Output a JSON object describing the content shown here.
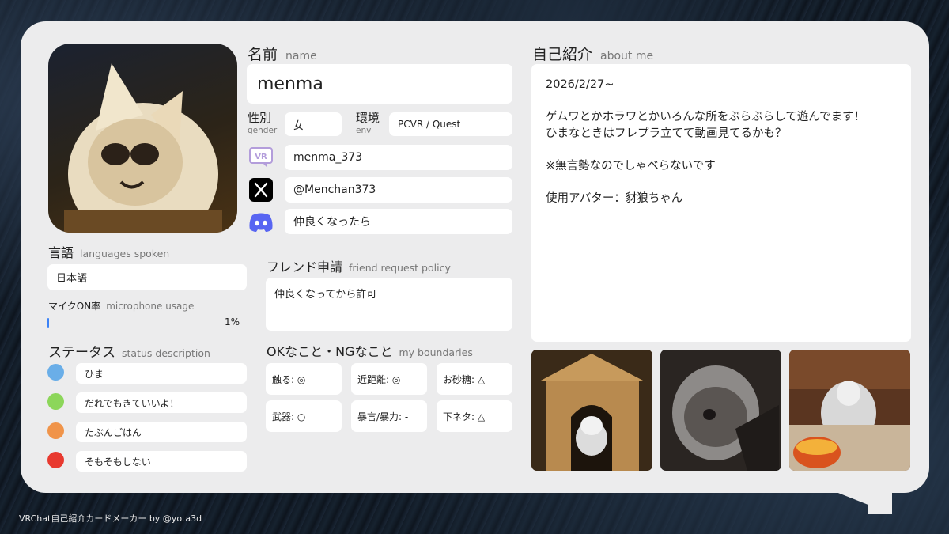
{
  "profile": {
    "name_label": "名前",
    "name_label_en": "name",
    "name": "menma",
    "gender_label": "性別",
    "gender_label_en": "gender",
    "gender": "女",
    "env_label": "環境",
    "env_label_en": "env",
    "env": "PCVR / Quest",
    "vrchat_id": "menma_373",
    "x_id": "@Menchan373",
    "discord": "仲良くなったら"
  },
  "languages": {
    "label": "言語",
    "label_en": "languages spoken",
    "value": "日本語"
  },
  "mic": {
    "label": "マイクON率",
    "label_en": "microphone usage",
    "value_text": "1%",
    "value": 1
  },
  "status": {
    "label": "ステータス",
    "label_en": "status description",
    "items": [
      {
        "text": "ひま",
        "color": "#6aaee8"
      },
      {
        "text": "だれでもきていいよ！",
        "color": "#8cd65a"
      },
      {
        "text": "たぶんごはん",
        "color": "#f0944a"
      },
      {
        "text": "そもそもしない",
        "color": "#e8392f"
      }
    ]
  },
  "friend": {
    "label": "フレンド申請",
    "label_en": "friend request policy",
    "value": "仲良くなってから許可"
  },
  "boundaries": {
    "label": "OKなこと・NGなこと",
    "label_en": "my boundaries",
    "items": [
      "触る: ◎",
      "近距離: ◎",
      "お砂糖: △",
      "武器: ○",
      "暴言/暴力: -",
      "下ネタ: △"
    ]
  },
  "about": {
    "label": "自己紹介",
    "label_en": "about me",
    "date": "2026/2/27~",
    "line1": "ゲムワとかホラワとかいろんな所をぶらぶらして遊んでます！",
    "line2": "ひまなときはフレプラ立てて動画見てるかも？",
    "line3": "※無言勢なのでしゃべらないです",
    "line4": "使用アバター：豺狼ちゃん"
  },
  "icons": {
    "vrchat": "vrchat-icon",
    "x": "x-logo-icon",
    "discord": "discord-icon"
  },
  "colors": {
    "card_bg": "#ececed",
    "field_bg": "#ffffff",
    "vrchat": "#b39ddb",
    "discord": "#5865f2",
    "mic_bar": "#3b82f6"
  },
  "footer": "VRChat自己紹介カードメーカー by @yota3d"
}
